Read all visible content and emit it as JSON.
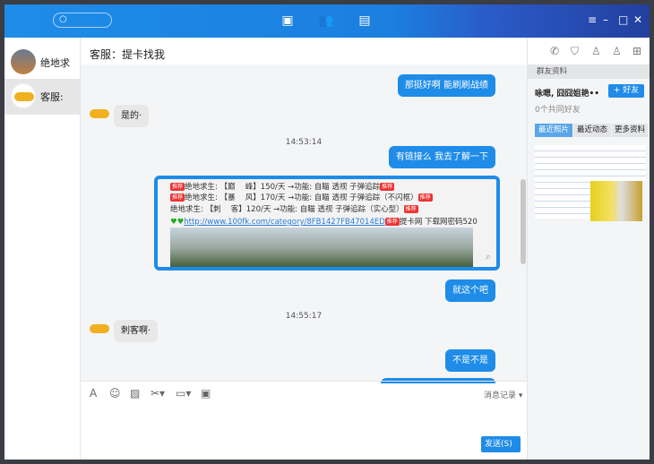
{
  "topbar": {
    "search_icon": "search-icon",
    "nav_icons": [
      "chat-icon",
      "contacts-icon",
      "files-icon"
    ],
    "window_controls": [
      "menu-icon",
      "minimize-icon",
      "maximize-icon",
      "close-icon"
    ]
  },
  "sidebar": {
    "contacts": [
      {
        "name": "绝地求"
      },
      {
        "name": "客服:",
        "selected": true
      }
    ]
  },
  "chat": {
    "title": "客服：提卡找我",
    "messages": [
      {
        "side": "right",
        "text": "那挺好啊  能刷刷战绩"
      },
      {
        "side": "left",
        "text": "是的·"
      },
      {
        "type": "time",
        "text": "14:53:14"
      },
      {
        "side": "right",
        "text": "有链接么  我去了解一下"
      },
      {
        "type": "card",
        "lines": [
          "绝地求生: 【巅　 峰】150/天 →功能: 自瞄 透视 子弹追踪",
          "绝地求生: 【暴　 风】170/天 →功能: 自瞄 透视 子弹追踪（不闪框）",
          "绝地求生: 【刺　 客】120/天 →功能: 自瞄 透视 子弹追踪（实心型）"
        ],
        "tag": "推荐",
        "link": "http://www.100fk.com/category/8FB1427FB47014ED",
        "link_suffix": "提卡网 下载网密码520"
      },
      {
        "side": "right",
        "text": "就这个吧"
      },
      {
        "type": "time",
        "text": "14:55:17"
      },
      {
        "side": "left",
        "text": "刺客啊·"
      },
      {
        "side": "right",
        "text": "不是不是"
      }
    ],
    "toolbar": {
      "icons": [
        "font-icon",
        "emoji-icon",
        "image-icon",
        "scissors-icon",
        "folder-icon",
        "history-doc-icon"
      ],
      "history_label": "消息记录"
    },
    "send_label": "发送(S)"
  },
  "right": {
    "icons": [
      "phone-icon",
      "shield-icon",
      "user-settings-icon",
      "add-user-icon",
      "add-group-icon"
    ],
    "section_title": "群友资料",
    "name": "咏嗯, 囧囧姐艳••",
    "add_friend": "+ 好友",
    "common_friends": "0个共同好友",
    "tabs": [
      "最近照片",
      "最近动态",
      "更多资料"
    ],
    "active_tab": 0
  },
  "colors": {
    "accent": "#1e8ce8"
  }
}
